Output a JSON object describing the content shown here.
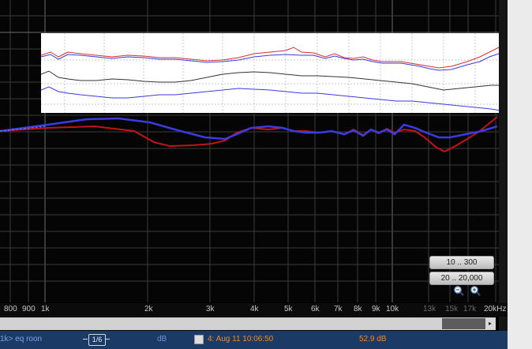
{
  "colors": {
    "blue_trace": "#3b3be0",
    "red_trace": "#c01515",
    "black_trace": "#333333",
    "grid": "#3a3a3a",
    "status_bg": "#1c3a66",
    "status_accent": "#e98a2c"
  },
  "icons": {
    "zoom_out": "magnifier-minus-icon",
    "zoom_in": "magnifier-plus-icon",
    "scroll_right": "arrow-right-icon"
  },
  "controls": {
    "range_a": "10 .. 300",
    "range_b": "20 .. 20,000"
  },
  "scroll_right_glyph": "▸",
  "freq_ticks": [
    {
      "label": "800",
      "dim": false
    },
    {
      "label": "900",
      "dim": false
    },
    {
      "label": "1k",
      "dim": false
    },
    {
      "label": "2k",
      "dim": false
    },
    {
      "label": "3k",
      "dim": false
    },
    {
      "label": "4k",
      "dim": false
    },
    {
      "label": "5k",
      "dim": false
    },
    {
      "label": "6k",
      "dim": false
    },
    {
      "label": "7k",
      "dim": false
    },
    {
      "label": "8k",
      "dim": false
    },
    {
      "label": "9k",
      "dim": false
    },
    {
      "label": "10k",
      "dim": false
    },
    {
      "label": "13k",
      "dim": true
    },
    {
      "label": "15k",
      "dim": true
    },
    {
      "label": "17k",
      "dim": true
    },
    {
      "label": "20kHz",
      "dim": false
    }
  ],
  "status": {
    "name": "1k> eq roon",
    "smoothing": "1/6",
    "unit": "dB",
    "measurement": "4: Aug 11 10:06:50",
    "value": "52.9 dB"
  }
}
